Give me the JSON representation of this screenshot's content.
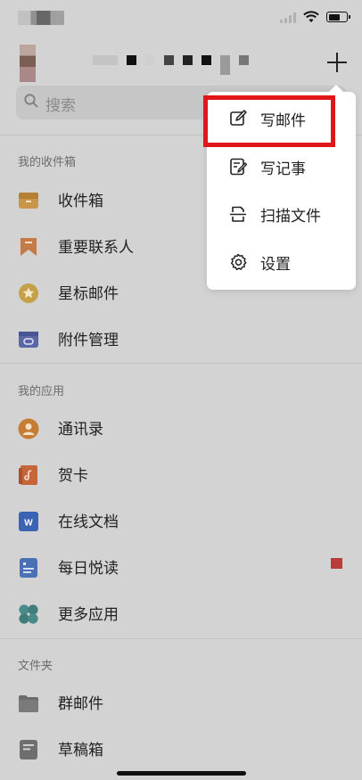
{
  "search": {
    "placeholder": "搜索"
  },
  "sections": {
    "inbox": "我的收件箱",
    "apps": "我的应用",
    "folders": "文件夹"
  },
  "inbox_items": [
    {
      "label": "收件箱",
      "icon": "inbox-icon",
      "color": "#d19b44"
    },
    {
      "label": "重要联系人",
      "icon": "bookmark-icon",
      "color": "#c97b4b"
    },
    {
      "label": "星标邮件",
      "icon": "star-icon",
      "color": "#c9a24a"
    },
    {
      "label": "附件管理",
      "icon": "attachment-icon",
      "color": "#5f6aa9"
    }
  ],
  "app_items": [
    {
      "label": "通讯录",
      "icon": "contacts-icon",
      "color": "#cc7f35"
    },
    {
      "label": "贺卡",
      "icon": "greeting-card-icon",
      "color": "#c9683a"
    },
    {
      "label": "在线文档",
      "icon": "document-icon",
      "color": "#3a66b8"
    },
    {
      "label": "每日悦读",
      "icon": "reading-icon",
      "color": "#4a72b8"
    },
    {
      "label": "更多应用",
      "icon": "more-apps-icon",
      "color": "#4c8b8a"
    }
  ],
  "folder_items": [
    {
      "label": "群邮件",
      "icon": "folder-icon",
      "color": "#6f6f6f"
    },
    {
      "label": "草稿箱",
      "icon": "drafts-icon",
      "color": "#6f6f6f"
    }
  ],
  "popup_menu": {
    "items": [
      {
        "label": "写邮件",
        "icon": "compose-icon"
      },
      {
        "label": "写记事",
        "icon": "note-icon"
      },
      {
        "label": "扫描文件",
        "icon": "scan-icon"
      },
      {
        "label": "设置",
        "icon": "settings-icon"
      }
    ],
    "highlight_color": "#e1161b"
  }
}
